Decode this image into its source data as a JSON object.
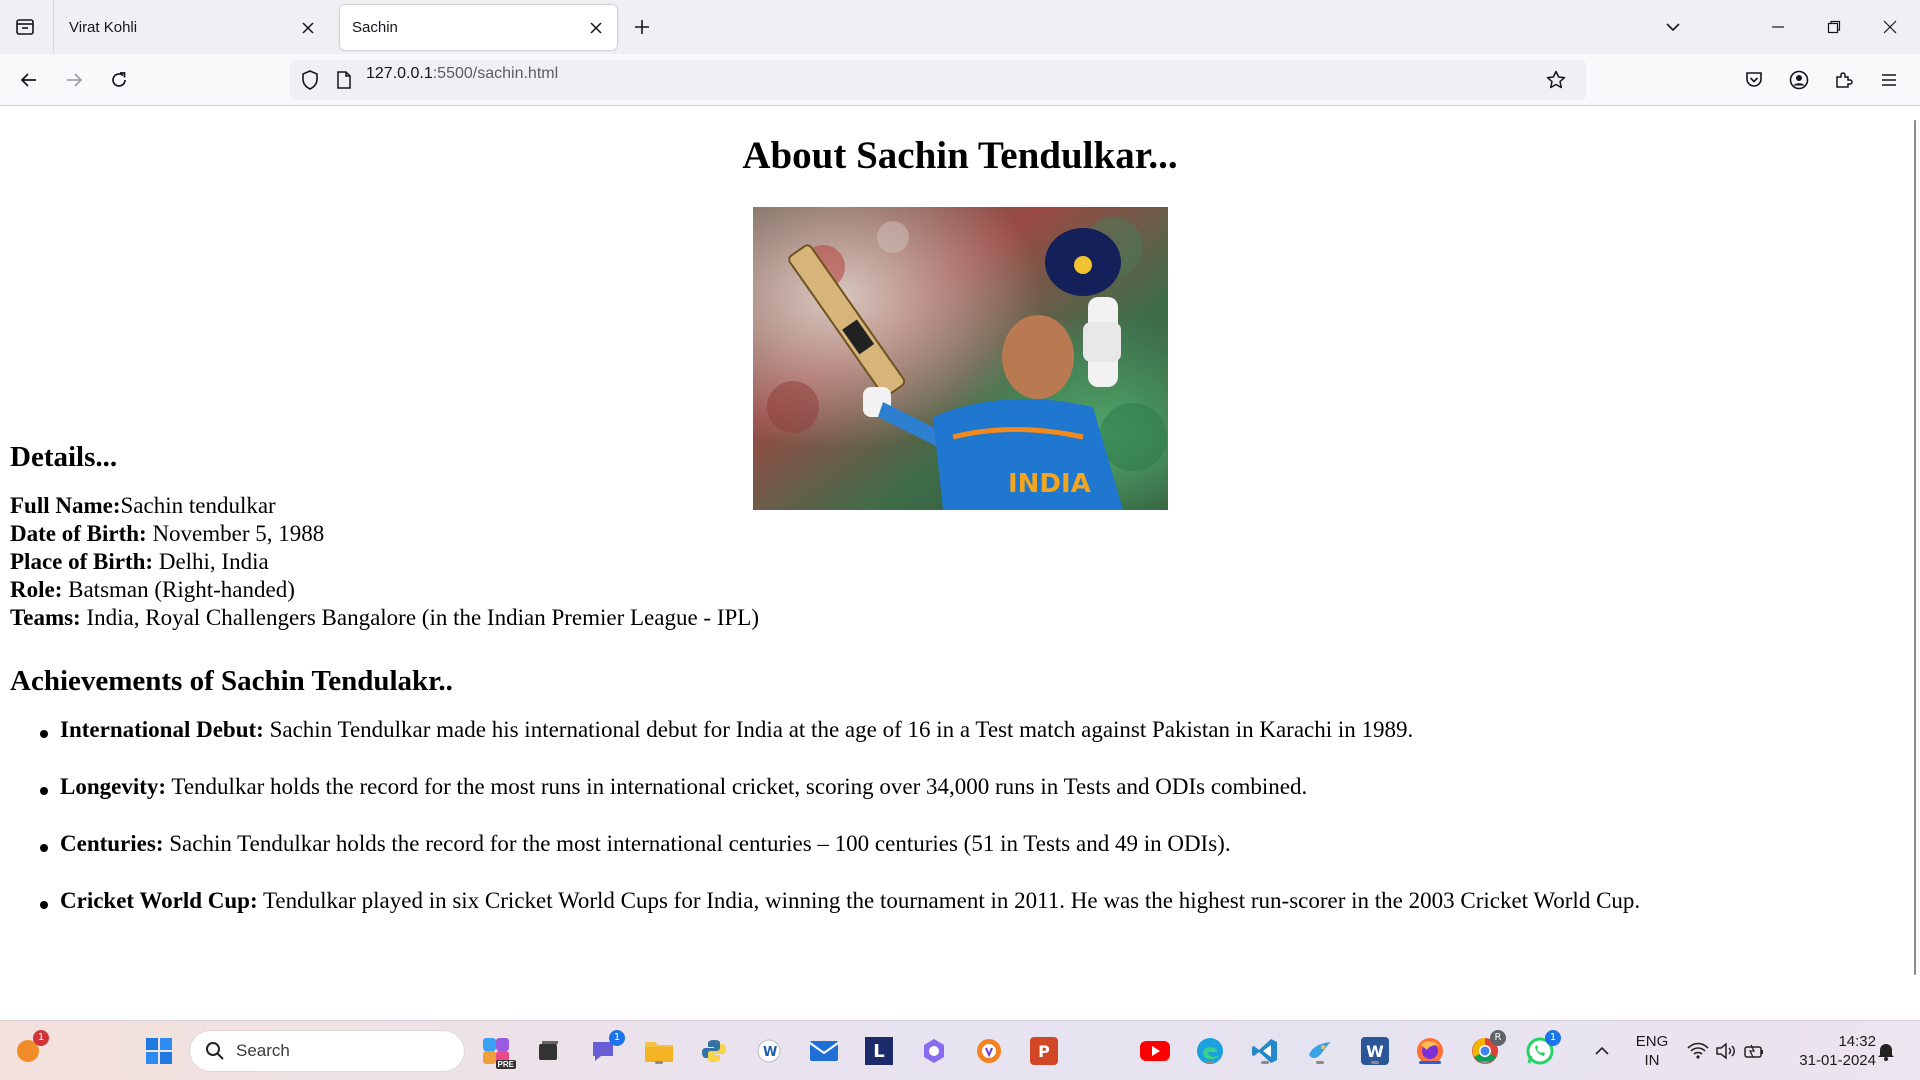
{
  "browser": {
    "tabs": [
      {
        "title": "Virat Kohli",
        "active": false
      },
      {
        "title": "Sachin",
        "active": true
      }
    ],
    "url": {
      "host": "127.0.0.1",
      "rest": ":5500/sachin.html"
    }
  },
  "page": {
    "title": "About Sachin Tendulkar...",
    "details_heading": "Details...",
    "details": [
      {
        "label": "Full Name:",
        "value": "Sachin tendulkar"
      },
      {
        "label": "Date of Birth:",
        "value": " November 5, 1988"
      },
      {
        "label": "Place of Birth:",
        "value": " Delhi, India"
      },
      {
        "label": "Role:",
        "value": " Batsman (Right-handed)"
      },
      {
        "label": "Teams:",
        "value": " India, Royal Challengers Bangalore (in the Indian Premier League - IPL)"
      }
    ],
    "achievements_heading": "Achievements of Sachin Tendulakr..",
    "achievements": [
      {
        "label": "International Debut:",
        "text": " Sachin Tendulkar made his international debut for India at the age of 16 in a Test match against Pakistan in Karachi in 1989."
      },
      {
        "label": "Longevity:",
        "text": " Tendulkar holds the record for the most runs in international cricket, scoring over 34,000 runs in Tests and ODIs combined."
      },
      {
        "label": "Centuries:",
        "text": " Sachin Tendulkar holds the record for the most international centuries – 100 centuries (51 in Tests and 49 in ODIs)."
      },
      {
        "label": "Cricket World Cup:",
        "text": " Tendulkar played in six Cricket World Cups for India, winning the tournament in 2011. He was the highest run-scorer in the 2003 Cricket World Cup."
      }
    ],
    "hero_image_text": "INDIA"
  },
  "taskbar": {
    "search_placeholder": "Search",
    "weather_badge": "1",
    "teams_badge": "1",
    "whatsapp_badge": "1",
    "chrome_badge": "R",
    "copilot_label": "PRE",
    "word_label": "W",
    "ppt_label": "P",
    "l_label": "L",
    "lang_line1": "ENG",
    "lang_line2": "IN",
    "time": "14:32",
    "date": "31-01-2024"
  },
  "colors": {
    "accent": "#2a5fd8",
    "badge_red": "#d13438",
    "badge_blue": "#1a73e8",
    "youtube": "#ff0000",
    "vscode": "#2489ca"
  }
}
